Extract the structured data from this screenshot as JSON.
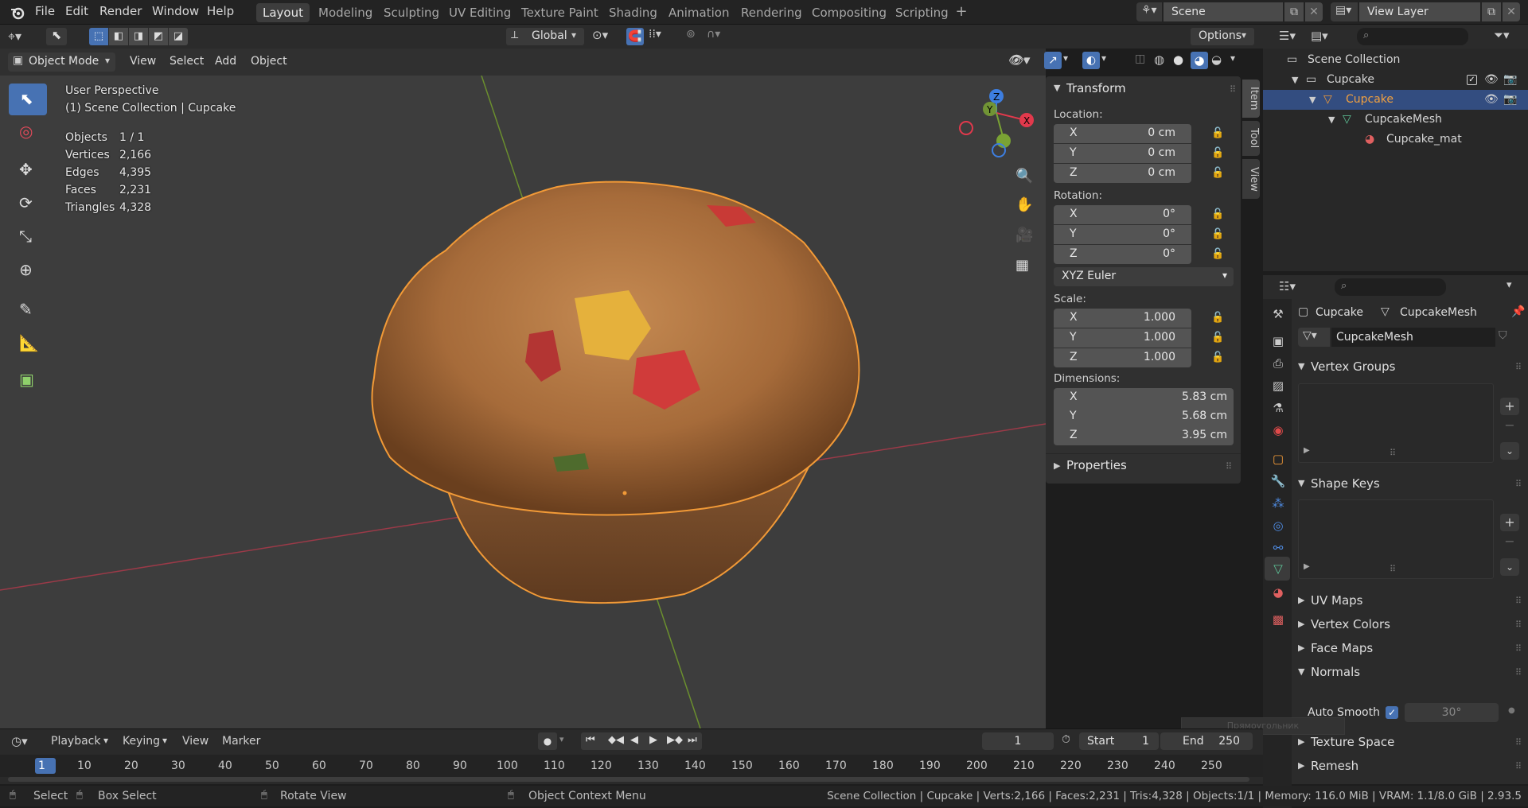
{
  "app": {
    "menu": [
      "File",
      "Edit",
      "Render",
      "Window",
      "Help"
    ],
    "workspaces": [
      "Layout",
      "Modeling",
      "Sculpting",
      "UV Editing",
      "Texture Paint",
      "Shading",
      "Animation",
      "Rendering",
      "Compositing",
      "Scripting"
    ],
    "active_workspace": "Layout",
    "scene_name": "Scene",
    "view_layer": "View Layer"
  },
  "toolbar": {
    "orientation": "Global",
    "options_label": "Options"
  },
  "viewport_header": {
    "mode": "Object Mode",
    "menus": [
      "View",
      "Select",
      "Add",
      "Object"
    ]
  },
  "viewport": {
    "perspective": "User Perspective",
    "collection_path": "(1) Scene Collection | Cupcake",
    "stats": [
      {
        "label": "Objects",
        "value": "1 / 1"
      },
      {
        "label": "Vertices",
        "value": "2,166"
      },
      {
        "label": "Edges",
        "value": "4,395"
      },
      {
        "label": "Faces",
        "value": "2,231"
      },
      {
        "label": "Triangles",
        "value": "4,328"
      }
    ],
    "gizmo_axes": [
      "Z",
      "X",
      "Y"
    ]
  },
  "npanel": {
    "transform_title": "Transform",
    "location_label": "Location:",
    "location": [
      {
        "axis": "X",
        "value": "0 cm"
      },
      {
        "axis": "Y",
        "value": "0 cm"
      },
      {
        "axis": "Z",
        "value": "0 cm"
      }
    ],
    "rotation_label": "Rotation:",
    "rotation": [
      {
        "axis": "X",
        "value": "0°"
      },
      {
        "axis": "Y",
        "value": "0°"
      },
      {
        "axis": "Z",
        "value": "0°"
      }
    ],
    "rotation_mode": "XYZ Euler",
    "scale_label": "Scale:",
    "scale": [
      {
        "axis": "X",
        "value": "1.000"
      },
      {
        "axis": "Y",
        "value": "1.000"
      },
      {
        "axis": "Z",
        "value": "1.000"
      }
    ],
    "dimensions_label": "Dimensions:",
    "dimensions": [
      {
        "axis": "X",
        "value": "5.83 cm"
      },
      {
        "axis": "Y",
        "value": "5.68 cm"
      },
      {
        "axis": "Z",
        "value": "3.95 cm"
      }
    ],
    "properties_title": "Properties",
    "tabs": [
      "Item",
      "Tool",
      "View"
    ]
  },
  "outliner": {
    "rows": [
      "Scene Collection",
      "Cupcake",
      "Cupcake",
      "CupcakeMesh",
      "Cupcake_mat"
    ]
  },
  "properties": {
    "breadcrumb_object": "Cupcake",
    "breadcrumb_mesh": "CupcakeMesh",
    "mesh_name": "CupcakeMesh",
    "panels": {
      "vertex_groups": "Vertex Groups",
      "shape_keys": "Shape Keys",
      "uv_maps": "UV Maps",
      "vertex_colors": "Vertex Colors",
      "face_maps": "Face Maps",
      "normals": "Normals",
      "auto_smooth": "Auto Smooth",
      "auto_smooth_angle": "30°",
      "texture_space": "Texture Space",
      "remesh": "Remesh"
    },
    "tooltip": "Прямоугольник"
  },
  "timeline": {
    "menus": [
      "Playback",
      "Keying",
      "View",
      "Marker"
    ],
    "current_frame": "1",
    "start_label": "Start",
    "start": "1",
    "end_label": "End",
    "end": "250",
    "ticks": [
      "1",
      "10",
      "20",
      "30",
      "40",
      "50",
      "60",
      "70",
      "80",
      "90",
      "100",
      "110",
      "120",
      "130",
      "140",
      "150",
      "160",
      "170",
      "180",
      "190",
      "200",
      "210",
      "220",
      "230",
      "240",
      "250"
    ]
  },
  "status": {
    "select": "Select",
    "box_select": "Box Select",
    "rotate_view": "Rotate View",
    "context_menu": "Object Context Menu",
    "info": "Scene Collection | Cupcake | Verts:2,166 | Faces:2,231 | Tris:4,328 | Objects:1/1 | Memory: 116.0 MiB | VRAM: 1.1/8.0 GiB | 2.93.5"
  },
  "colors": {
    "accent": "#4772b3",
    "selected_orange": "#f29a37",
    "axis_x": "#e2394c",
    "axis_y": "#7aa334",
    "axis_z": "#3d7ee0"
  }
}
